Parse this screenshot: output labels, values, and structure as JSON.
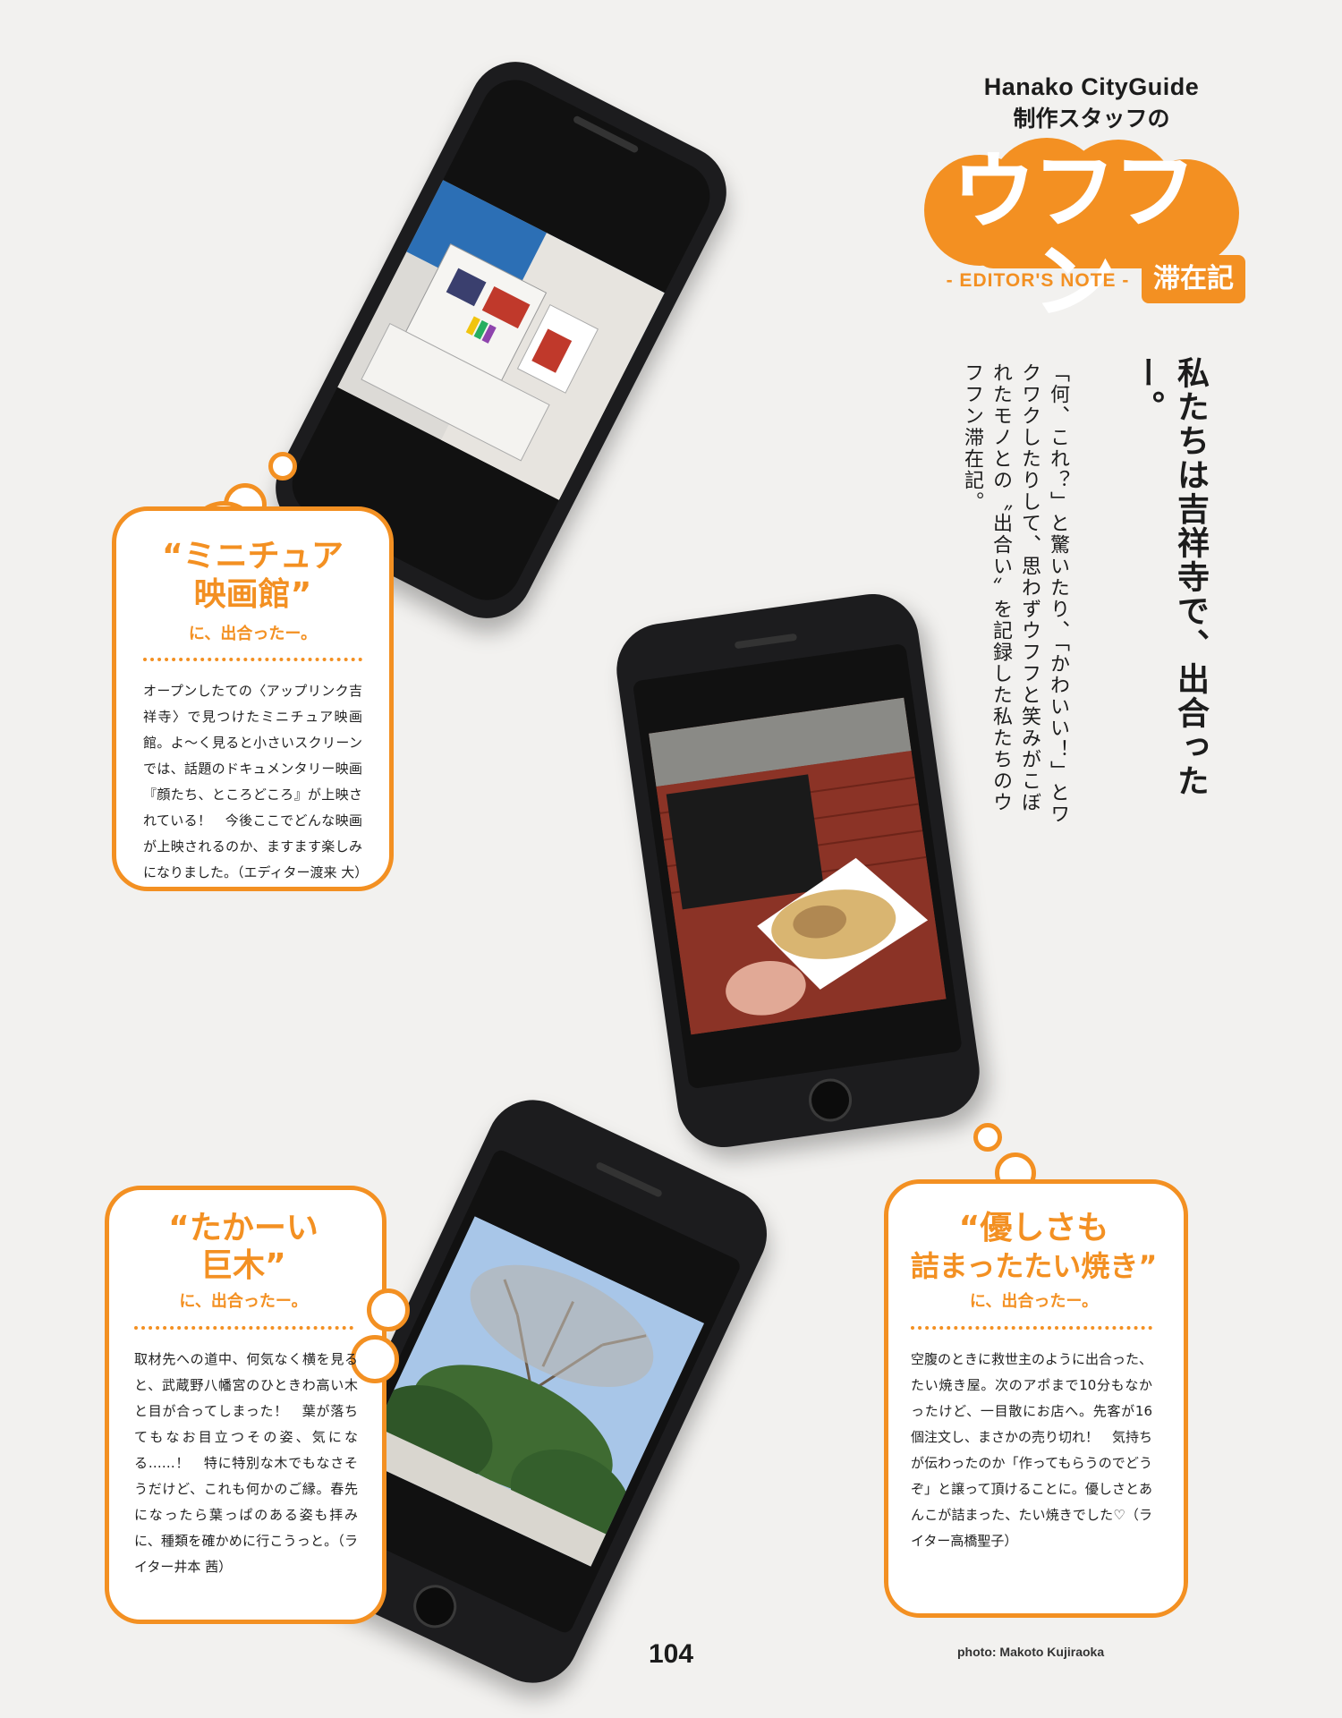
{
  "header": {
    "brand": "Hanako CityGuide",
    "subtitle": "制作スタッフの",
    "title": "ウフフン",
    "badge": "滞在記",
    "editors_note": "- EDITOR'S NOTE -"
  },
  "intro": {
    "headline": "私たちは吉祥寺で、出合ったー。",
    "body": "「何、これ？」と驚いたり、「かわいい！」とワクワクしたりして、思わずウフフと笑みがこぼれたモノとの〝出合い〟を記録した私たちのウフフン滞在記。"
  },
  "notes": [
    {
      "title_line1": "“ミニチュア",
      "title_line2": "映画館”",
      "subtitle": "に、出合ったー。",
      "body": "オープンしたての〈アップリンク吉祥寺〉で見つけたミニチュア映画館。よ〜く見ると小さいスクリーンでは、話題のドキュメンタリー映画『顔たち、ところどころ』が上映されている！　今後ここでどんな映画が上映されるのか、ますます楽しみになりました。（エディター渡来 大）"
    },
    {
      "title_line1": "“たかーい",
      "title_line2": "巨木”",
      "subtitle": "に、出合ったー。",
      "body": "取材先への道中、何気なく横を見ると、武蔵野八幡宮のひときわ高い木と目が合ってしまった！　葉が落ちてもなお目立つその姿、気になる……！　特に特別な木でもなさそうだけど、これも何かのご縁。春先になったら葉っぱのある姿も拝みに、種類を確かめに行こうっと。（ライター井本 茜）"
    },
    {
      "title_line1": "“優しさも",
      "title_line2": "詰まったたい焼き”",
      "subtitle": "に、出合ったー。",
      "body": "空腹のときに救世主のように出合った、たい焼き屋。次のアポまで10分もなかったけど、一目散にお店へ。先客が16個注文し、まさかの売り切れ！　気持ちが伝わったのか「作ってもらうのでどうぞ」と譲って頂けることに。優しさとあんこが詰まった、たい焼きでした♡（ライター高橋聖子）"
    }
  ],
  "footer": {
    "page_number": "104",
    "photo_credit": "photo: Makoto Kujiraoka"
  },
  "colors": {
    "accent": "#f39022",
    "background": "#f2f1ef",
    "phone_body": "#1c1c1e"
  }
}
